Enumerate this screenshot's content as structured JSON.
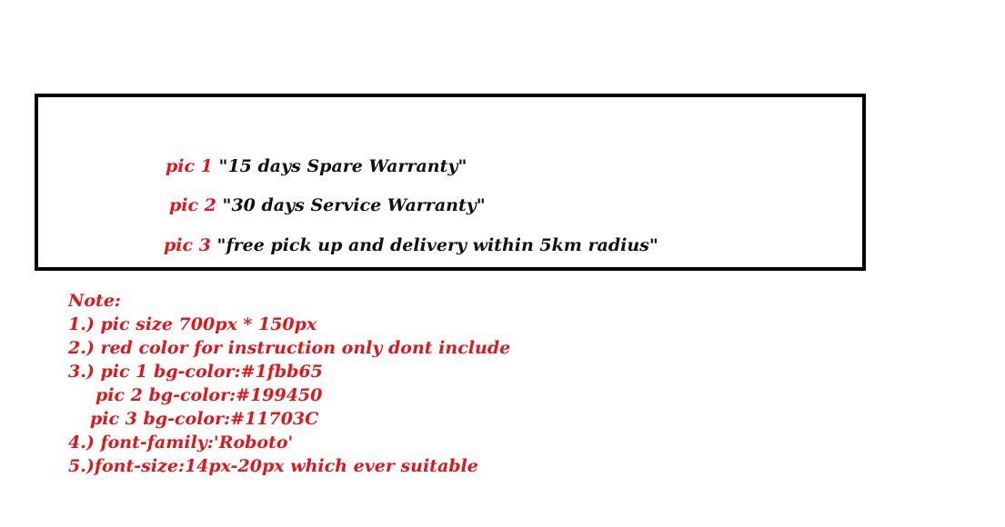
{
  "box": {
    "lines": [
      {
        "pic": "pic 1",
        "text": "\"15 days Spare Warranty\""
      },
      {
        "pic": "pic 2",
        "text": "\"30 days Service Warranty\""
      },
      {
        "pic": "pic 3",
        "text": "\"free pick up and delivery within 5km radius\""
      }
    ]
  },
  "notes": {
    "title": "Note:",
    "items": [
      "1.) pic size 700px * 150px",
      "2.) red color for instruction only dont include",
      "3.) pic 1 bg-color:#1fbb65",
      "pic 2 bg-color:#199450",
      "pic 3 bg-color:#11703C",
      "4.) font-family:'Roboto'",
      "5.)font-size:14px-20px which ever suitable"
    ]
  },
  "colors": {
    "instruction": "#e0161b",
    "text": "#111111",
    "border": "#000000"
  }
}
